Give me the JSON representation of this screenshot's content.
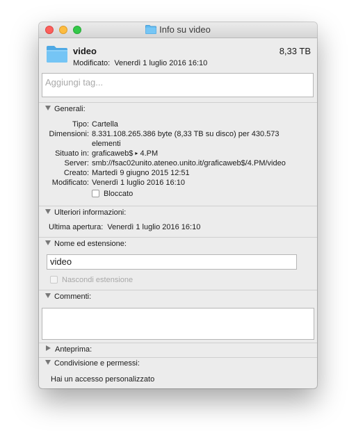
{
  "window": {
    "title": "Info su video"
  },
  "header": {
    "name": "video",
    "size": "8,33 TB",
    "modified_label": "Modificato:",
    "modified_value": "Venerdì 1 luglio 2016 16:10"
  },
  "tags": {
    "placeholder": "Aggiungi tag..."
  },
  "generali": {
    "heading": "Generali:",
    "tipo_label": "Tipo:",
    "tipo_value": "Cartella",
    "dim_label": "Dimensioni:",
    "dim_value": "8.331.108.265.386 byte (8,33 TB su disco) per 430.573 elementi",
    "situato_label": "Situato in:",
    "situato_value": "graficaweb$",
    "situato_sub": "4.PM",
    "server_label": "Server:",
    "server_value": "smb://fsac02unito.ateneo.unito.it/graficaweb$/4.PM/video",
    "creato_label": "Creato:",
    "creato_value": "Martedì 9 giugno 2015 12:51",
    "modificato_label": "Modificato:",
    "modificato_value": "Venerdì 1 luglio 2016 16:10",
    "bloccato_label": "Bloccato"
  },
  "ulteriori": {
    "heading": "Ulteriori informazioni:",
    "ultima_label": "Ultima apertura:",
    "ultima_value": "Venerdì 1 luglio 2016 16:10"
  },
  "nome": {
    "heading": "Nome ed estensione:",
    "value": "video",
    "nascondi_label": "Nascondi estensione"
  },
  "commenti": {
    "heading": "Commenti:"
  },
  "anteprima": {
    "heading": "Anteprima:"
  },
  "condivisione": {
    "heading": "Condivisione e permessi:",
    "text": "Hai un accesso personalizzato"
  },
  "colors": {
    "folder": "#5fb9f0",
    "close": "#fc605c",
    "minimize": "#fdbc40",
    "maximize": "#34c84a"
  }
}
